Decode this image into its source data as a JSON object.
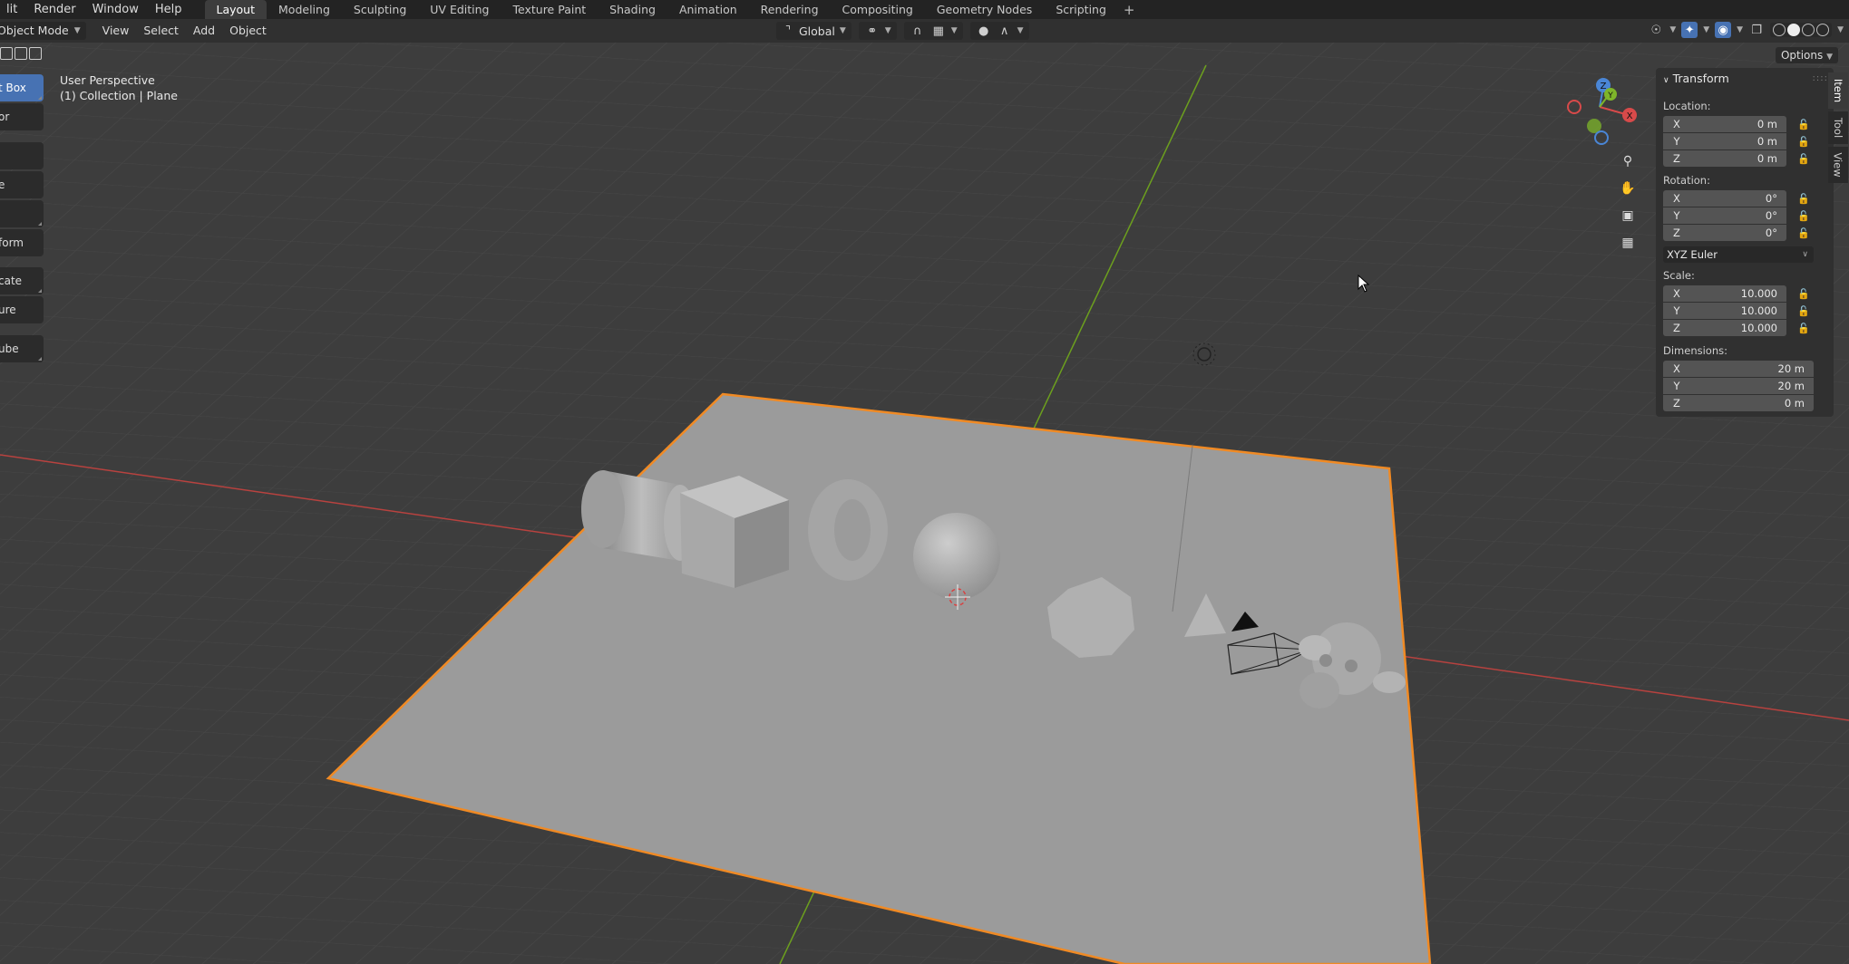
{
  "menu": [
    "lit",
    "Render",
    "Window",
    "Help"
  ],
  "workspaces": [
    {
      "label": "Layout",
      "active": true
    },
    {
      "label": "Modeling"
    },
    {
      "label": "Sculpting"
    },
    {
      "label": "UV Editing"
    },
    {
      "label": "Texture Paint"
    },
    {
      "label": "Shading"
    },
    {
      "label": "Animation"
    },
    {
      "label": "Rendering"
    },
    {
      "label": "Compositing"
    },
    {
      "label": "Geometry Nodes"
    },
    {
      "label": "Scripting"
    }
  ],
  "header": {
    "mode": "Object Mode",
    "menus": [
      "View",
      "Select",
      "Add",
      "Object"
    ],
    "orientation": "Global"
  },
  "viewport": {
    "perspective": "User Perspective",
    "collection": "(1) Collection | Plane",
    "options": "Options"
  },
  "tools": [
    "t Box",
    "or",
    "",
    "e",
    "",
    "form",
    "cate",
    "ure",
    "ube"
  ],
  "gizmo": {
    "x": "X",
    "y": "Y",
    "z": "Z"
  },
  "transform": {
    "title": "Transform",
    "location_label": "Location:",
    "location": {
      "x": "0 m",
      "y": "0 m",
      "z": "0 m"
    },
    "rotation_label": "Rotation:",
    "rotation": {
      "x": "0°",
      "y": "0°",
      "z": "0°"
    },
    "rotation_mode": "XYZ Euler",
    "scale_label": "Scale:",
    "scale": {
      "x": "10.000",
      "y": "10.000",
      "z": "10.000"
    },
    "dimensions_label": "Dimensions:",
    "dimensions": {
      "x": "20 m",
      "y": "20 m",
      "z": "0 m"
    },
    "axes": {
      "x": "X",
      "y": "Y",
      "z": "Z"
    }
  },
  "sidebar_tabs": [
    "Item",
    "Tool",
    "View"
  ],
  "colors": {
    "accent": "#4772b3",
    "selection": "#f08a24",
    "axis_x": "#b8423f",
    "axis_y": "#6c9f1e"
  }
}
